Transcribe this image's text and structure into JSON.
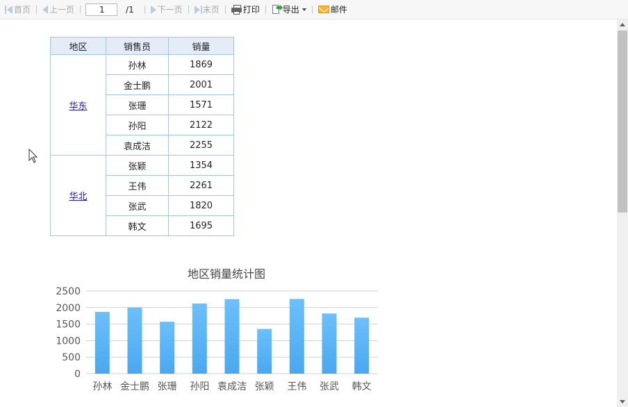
{
  "toolbar": {
    "first": "首页",
    "prev": "上一页",
    "page_value": "1",
    "page_total": "/1",
    "next": "下一页",
    "last": "末页",
    "print": "打印",
    "export": "导出",
    "mail": "邮件"
  },
  "table": {
    "headers": [
      "地区",
      "销售员",
      "销量"
    ],
    "groups": [
      {
        "region": "华东",
        "rows": [
          {
            "seller": "孙林",
            "sales": "1869"
          },
          {
            "seller": "金士鹏",
            "sales": "2001"
          },
          {
            "seller": "张珊",
            "sales": "1571"
          },
          {
            "seller": "孙阳",
            "sales": "2122"
          },
          {
            "seller": "袁成洁",
            "sales": "2255"
          }
        ]
      },
      {
        "region": "华北",
        "rows": [
          {
            "seller": "张颖",
            "sales": "1354"
          },
          {
            "seller": "王伟",
            "sales": "2261"
          },
          {
            "seller": "张武",
            "sales": "1820"
          },
          {
            "seller": "韩文",
            "sales": "1695"
          }
        ]
      }
    ]
  },
  "chart_data": {
    "type": "bar",
    "title": "地区销量统计图",
    "categories": [
      "孙林",
      "金士鹏",
      "张珊",
      "孙阳",
      "袁成洁",
      "张颖",
      "王伟",
      "张武",
      "韩文"
    ],
    "values": [
      1869,
      2001,
      1571,
      2122,
      2255,
      1354,
      2261,
      1820,
      1695
    ],
    "yticks": [
      "0",
      "500",
      "1000",
      "1500",
      "2000",
      "2500"
    ],
    "ylim": [
      0,
      2500
    ],
    "xlabel": "",
    "ylabel": "",
    "grid": true,
    "legend": "none",
    "bar_color_top": "#6cc0fa",
    "bar_color_bottom": "#4aa8f0"
  }
}
